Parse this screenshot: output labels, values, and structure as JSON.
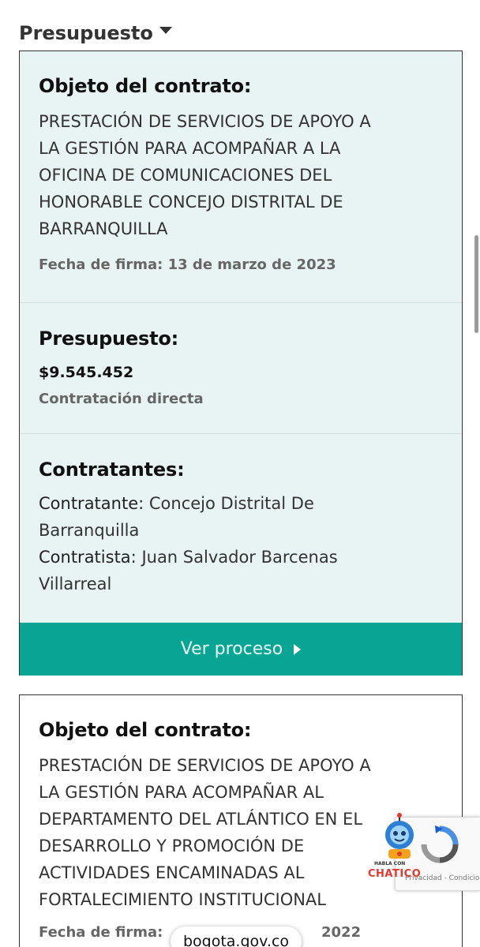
{
  "sort": {
    "label": "Presupuesto"
  },
  "cards": [
    {
      "object_heading": "Objeto del contrato:",
      "object_text": [
        "PRESTACIÓN DE SERVICIOS DE APOYO A",
        "LA GESTIÓN PARA ACOMPAÑAR A LA",
        "OFICINA DE COMUNICACIONES DEL",
        "HONORABLE CONCEJO DISTRITAL DE",
        "BARRANQUILLA"
      ],
      "signed_date": "Fecha de firma: 13 de marzo de 2023",
      "budget_heading": "Presupuesto:",
      "budget_amount": "$9.545.452",
      "budget_modality": "Contratación directa",
      "parties_heading": "Contratantes:",
      "contracting_label": "Contratante:",
      "contracting_value_1": "Concejo Distrital De",
      "contracting_value_2": "Barranquilla",
      "contractor_label": "Contratista:",
      "contractor_value_1": "Juan Salvador Barcenas",
      "contractor_value_2": "Villarreal",
      "cta_label": "Ver proceso"
    },
    {
      "object_heading": "Objeto del contrato:",
      "object_text": [
        "PRESTACIÓN DE SERVICIOS DE APOYO A",
        "LA GESTIÓN PARA ACOMPAÑAR AL",
        "DEPARTAMENTO DEL ATLÁNTICO EN EL",
        "DESARROLLO Y PROMOCIÓN DE",
        "ACTIVIDADES ENCAMINADAS AL",
        "FORTALECIMIENTO INSTITUCIONAL"
      ],
      "signed_date_partial": "Fecha de firma:",
      "signed_year_partial": "2022"
    }
  ],
  "overlays": {
    "recaptcha_terms": "Privacidad - Condiciones",
    "chatico_tag": "HABLA CON",
    "chatico_brand": "CHATICO",
    "url": "bogota.gov.co"
  },
  "colors": {
    "card_bg": "#e8f3f3",
    "cta_bg": "#08a594",
    "text_dark": "#111111",
    "text_muted": "#666666"
  },
  "icons": {
    "sort_caret": "caret-down-icon",
    "cta_arrow": "caret-right-icon",
    "recaptcha": "recaptcha-logo-icon",
    "chatbot": "chatbot-robot-icon"
  }
}
